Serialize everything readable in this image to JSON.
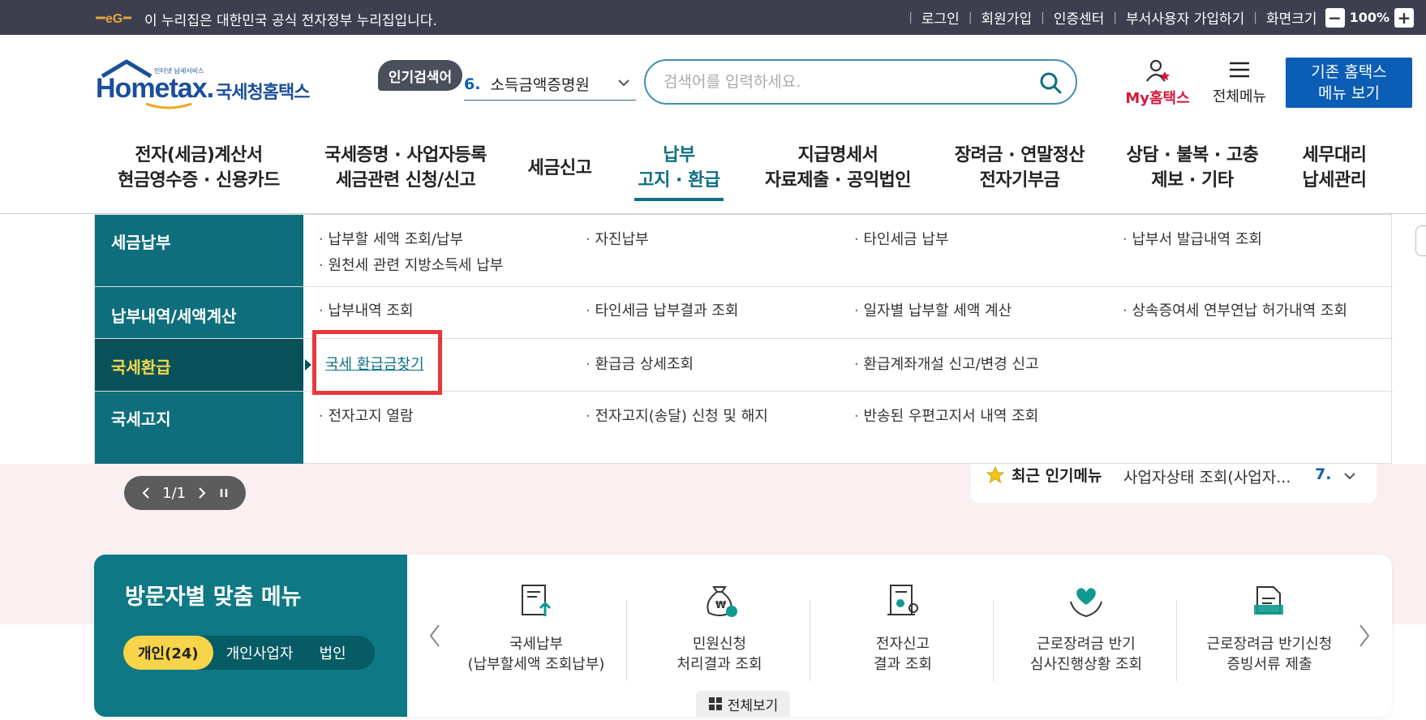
{
  "gov_bar": {
    "text": "이 누리집은 대한민국 공식 전자정부 누리집입니다.",
    "links": [
      "로그인",
      "회원가입",
      "인증센터",
      "부서사용자 가입하기",
      "화면크기"
    ],
    "zoom": "100%",
    "zoom_minus": "−",
    "zoom_plus": "+"
  },
  "header": {
    "logo_main": "Hometax.",
    "logo_sub": "국세청홈택스",
    "logo_tiny": "인터넷 납세서비스",
    "popular_label": "인기검색어",
    "popular_num": "6.",
    "popular_term": "소득금액증명원",
    "search_placeholder": "검색어를 입력하세요.",
    "my_hometax": "My홈택스",
    "all_menu": "전체메뉴",
    "old_btn_line1": "기존 홈택스",
    "old_btn_line2": "메뉴 보기"
  },
  "gnb": [
    {
      "l1": "전자(세금)계산서",
      "l2": "현금영수증 · 신용카드"
    },
    {
      "l1": "국세증명 · 사업자등록",
      "l2": "세금관련 신청/신고"
    },
    {
      "l1": "세금신고",
      "l2": ""
    },
    {
      "l1": "납부",
      "l2": "고지 · 환급"
    },
    {
      "l1": "지급명세서",
      "l2": "자료제출 · 공익법인"
    },
    {
      "l1": "장려금 · 연말정산",
      "l2": "전자기부금"
    },
    {
      "l1": "상담 · 불복 · 고충",
      "l2": "제보 · 기타"
    },
    {
      "l1": "세무대리",
      "l2": "납세관리"
    }
  ],
  "dropdown": {
    "rows": [
      {
        "cat": "세금납부",
        "links": [
          "납부할 세액 조회/납부",
          "자진납부",
          "타인세금 납부",
          "납부서 발급내역 조회",
          "원천세 관련 지방소득세 납부"
        ]
      },
      {
        "cat": "납부내역/세액계산",
        "links": [
          "납부내역 조회",
          "타인세금 납부결과 조회",
          "일자별 납부할 세액 계산",
          "상속증여세 연부연납 허가내역 조회"
        ]
      },
      {
        "cat": "국세환급",
        "links": [
          "국세 환급금찾기",
          "환급금 상세조회",
          "환급계좌개설 신고/변경 신고"
        ]
      },
      {
        "cat": "국세고지",
        "links": [
          "전자고지 열람",
          "전자고지(송달) 신청 및 해지",
          "반송된 우편고지서 내역 조회"
        ]
      }
    ]
  },
  "slider": {
    "page": "1/1"
  },
  "recent": {
    "title": "최근 인기메뉴",
    "item": "사업자상태 조회(사업자...",
    "num": "7."
  },
  "custom_menu": {
    "title": "방문자별 맞춤 메뉴",
    "segments": [
      "개인(24)",
      "개인사업자",
      "법인"
    ],
    "services": [
      {
        "l1": "국세납부",
        "l2": "(납부할세액 조회납부)"
      },
      {
        "l1": "민원신청",
        "l2": "처리결과 조회"
      },
      {
        "l1": "전자신고",
        "l2": "결과 조회"
      },
      {
        "l1": "근로장려금 반기",
        "l2": "심사진행상황 조회"
      },
      {
        "l1": "근로장려금 반기신청",
        "l2": "증빙서류 제출"
      }
    ],
    "view_all": "전체보기"
  },
  "colors": {
    "teal": "#0e6e7c",
    "dark_teal": "#085159",
    "accent_yellow": "#f7d44a",
    "highlight_red": "#e8383b",
    "brand_blue": "#0b5db6"
  }
}
